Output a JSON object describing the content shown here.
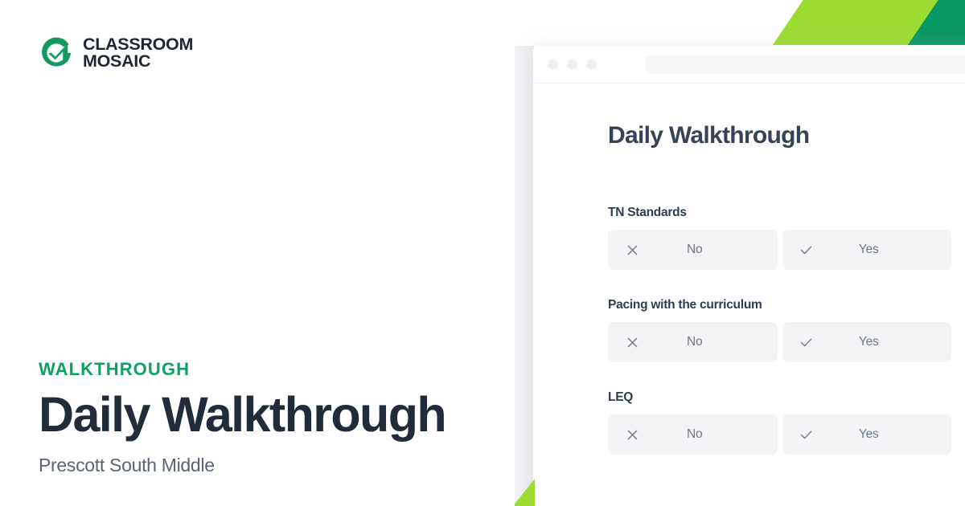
{
  "brand": {
    "logo_icon": "classroom-mosaic-check-logo",
    "line1": "CLASSROOM",
    "line2": "MOSAIC",
    "accent_green": "#12A060",
    "logo_green": "#139A60"
  },
  "hero": {
    "eyebrow": "WALKTHROUGH",
    "title": "Daily Walkthrough",
    "subtitle": "Prescott South Middle"
  },
  "decor": {
    "lime": "#9BDD33",
    "teal": "#099863"
  },
  "browser": {
    "dots": [
      "dot-1",
      "dot-2",
      "dot-3"
    ],
    "address_bar_value": ""
  },
  "card": {
    "title": "Daily Walkthrough",
    "questions": [
      {
        "label": "TN Standards",
        "options": [
          {
            "icon": "x-icon",
            "label": "No"
          },
          {
            "icon": "check-icon",
            "label": "Yes"
          }
        ]
      },
      {
        "label": "Pacing with the curriculum",
        "options": [
          {
            "icon": "x-icon",
            "label": "No"
          },
          {
            "icon": "check-icon",
            "label": "Yes"
          }
        ]
      },
      {
        "label": "LEQ",
        "options": [
          {
            "icon": "x-icon",
            "label": "No"
          },
          {
            "icon": "check-icon",
            "label": "Yes"
          }
        ]
      }
    ]
  }
}
